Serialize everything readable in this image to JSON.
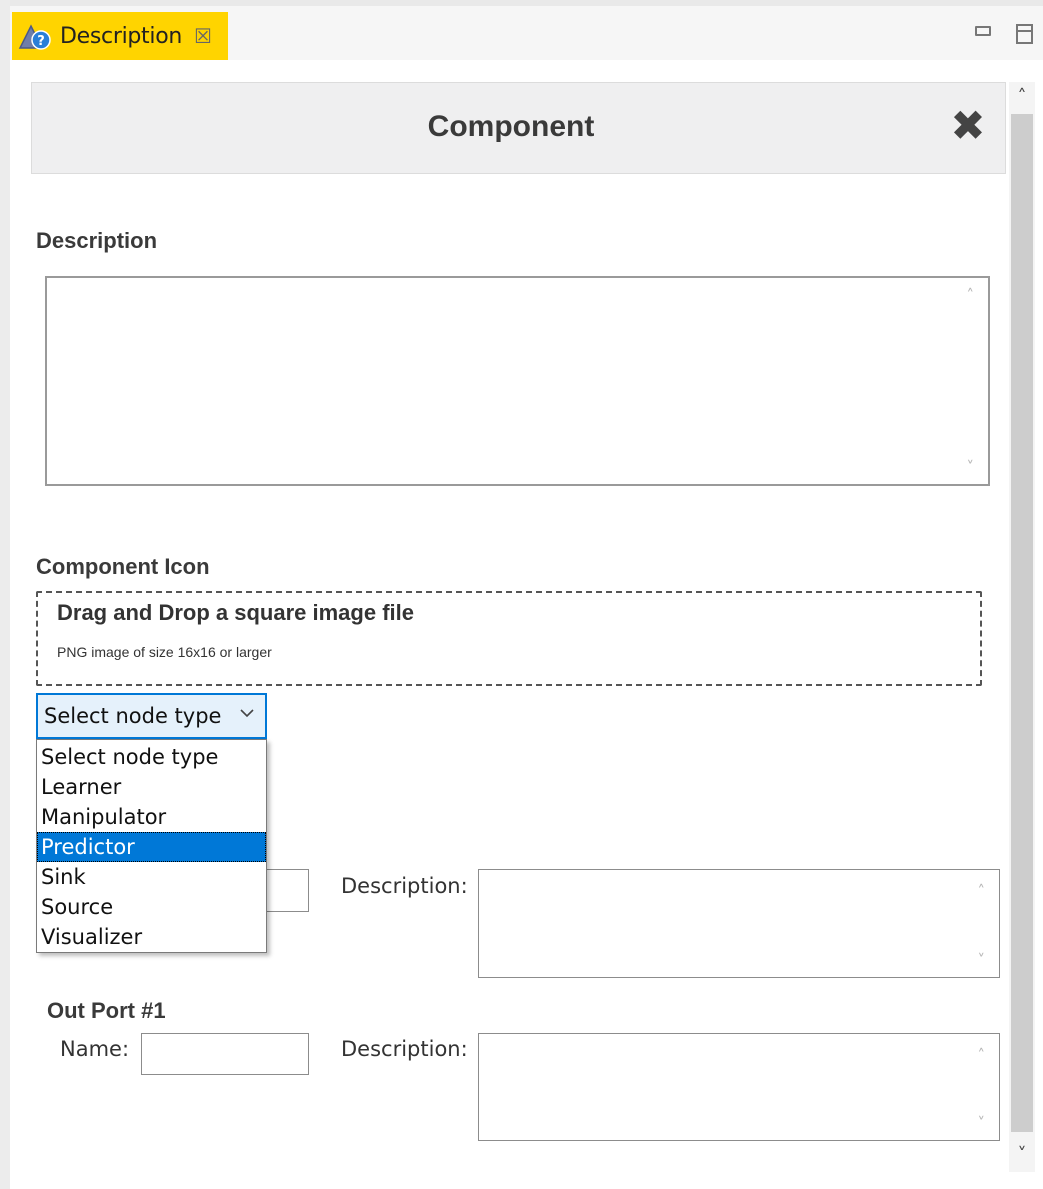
{
  "view_tab": {
    "title": "Description",
    "close_glyph": "☒",
    "icon": "description-view-icon"
  },
  "window_controls": {
    "minimize_icon": "minimize-icon",
    "maximize_icon": "maximize-icon"
  },
  "header": {
    "title": "Component",
    "close_glyph": "✖"
  },
  "description_section": {
    "label": "Description",
    "value": ""
  },
  "icon_section": {
    "label": "Component Icon",
    "drop_title": "Drag and Drop a square image file",
    "drop_hint": "PNG image of size 16x16 or larger"
  },
  "node_type_select": {
    "selected": "Select node type",
    "options": [
      "Select node type",
      "Learner",
      "Manipulator",
      "Predictor",
      "Sink",
      "Source",
      "Visualizer"
    ],
    "highlighted": "Predictor"
  },
  "in_port": {
    "description_label": "Description:",
    "name_value": "",
    "description_value": ""
  },
  "out_port": {
    "title": "Out Port #1",
    "name_label": "Name:",
    "description_label": "Description:",
    "name_value": "",
    "description_value": ""
  },
  "scrollbar": {
    "up_glyph": "˄",
    "down_glyph": "˅"
  },
  "colors": {
    "tab_accent": "#ffd400",
    "selection": "#0078d7",
    "select_background": "#e5f1fb"
  }
}
